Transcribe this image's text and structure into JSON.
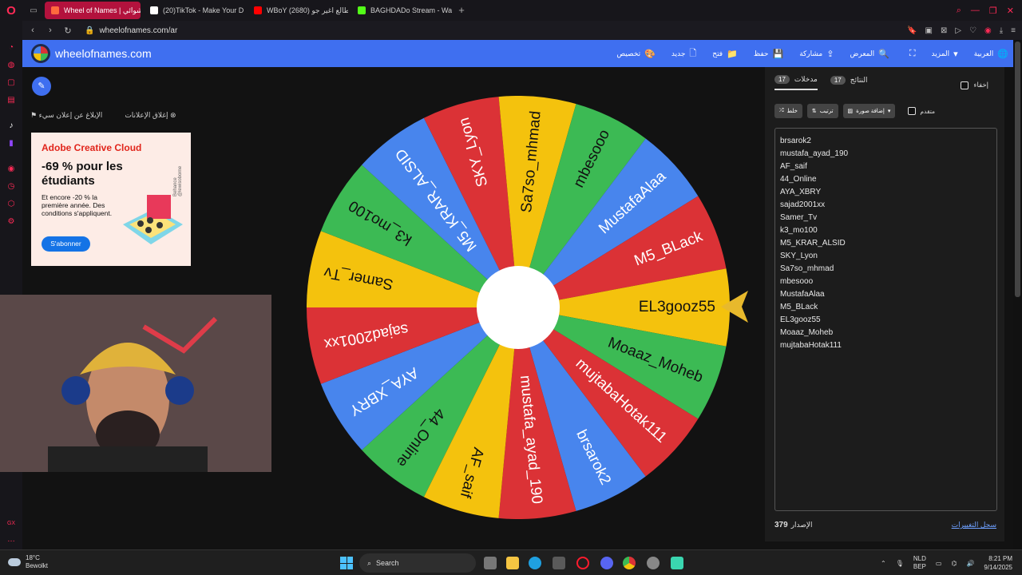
{
  "browser": {
    "tabs": [
      {
        "label": "Wheel of Names | عشوائي",
        "active": true,
        "color": "#ff6a3d"
      },
      {
        "label": "(20)TikTok - Make Your D",
        "active": false,
        "color": "#ffffff"
      },
      {
        "label": "WBoY طالع اغير جو (2680)",
        "active": false,
        "color": "#ff0000"
      },
      {
        "label": "BAGHDADo Stream - Wat",
        "active": false,
        "color": "#53fc18"
      }
    ],
    "new_tab": "+",
    "url": "wheelofnames.com/ar"
  },
  "header": {
    "site_name": "wheelofnames.com",
    "menu": [
      {
        "label": "تخصيص",
        "icon": "palette-icon",
        "glyph": "🎨"
      },
      {
        "label": "جديد",
        "icon": "new-file-icon",
        "glyph": "🗋"
      },
      {
        "label": "فتح",
        "icon": "folder-icon",
        "glyph": "📁"
      },
      {
        "label": "حفظ",
        "icon": "save-icon",
        "glyph": "💾"
      },
      {
        "label": "مشاركة",
        "icon": "share-icon",
        "glyph": "⇪"
      },
      {
        "label": "المعرض",
        "icon": "search-icon",
        "glyph": "🔍"
      },
      {
        "label": "",
        "icon": "fullscreen-icon",
        "glyph": "⛶"
      },
      {
        "label": "المزيد",
        "icon": "chevron-down-icon",
        "glyph": "▾"
      },
      {
        "label": "العربية",
        "icon": "globe-icon",
        "glyph": "🌐"
      }
    ]
  },
  "ad": {
    "report_link": "الإبلاغ عن إعلان سيء",
    "close_link": "إغلاق الإعلانات",
    "brand": "Adobe Creative Cloud",
    "headline": "-69 % pour les étudiants",
    "body": "Et encore -20 % la première année. Des conditions s'appliquent.",
    "cta": "S'abonner",
    "side_text": "Behance @lewisoborne"
  },
  "wheel": {
    "colors": [
      "#4885ed",
      "#db3236",
      "#3cba54",
      "#f4c20d"
    ]
  },
  "panel": {
    "tab_entries": "مدخلات",
    "tab_entries_count": "17",
    "tab_results": "النتائج",
    "tab_results_count": "17",
    "hide_label": "إخفاء",
    "shuffle_label": "خلط",
    "sort_label": "ترتيب",
    "add_image_label": "إضافة صورة",
    "advanced_label": "متقدم",
    "version_label": "الإصدار",
    "version_number": "379",
    "changelog_link": "سجل التغييرات"
  },
  "entries": [
    "brsarok2",
    "mustafa_ayad_190",
    "AF_saif",
    "44_Online",
    "AYA_XBRY",
    "sajad2001xx",
    "Samer_Tv",
    "k3_mo100",
    "M5_KRAR_ALSID",
    "SKY_Lyon",
    "Sa7so_mhmad",
    "mbesooo",
    "MustafaAlaa",
    "M5_BLack",
    "EL3gooz55",
    "Moaaz_Moheb",
    "mujtabaHotak111"
  ],
  "taskbar": {
    "temperature": "18°C",
    "weather": "Bewolkt",
    "search": "Search",
    "lang_top": "NLD",
    "lang_bottom": "BEP",
    "time": "8:21 PM",
    "date": "9/14/2025"
  }
}
